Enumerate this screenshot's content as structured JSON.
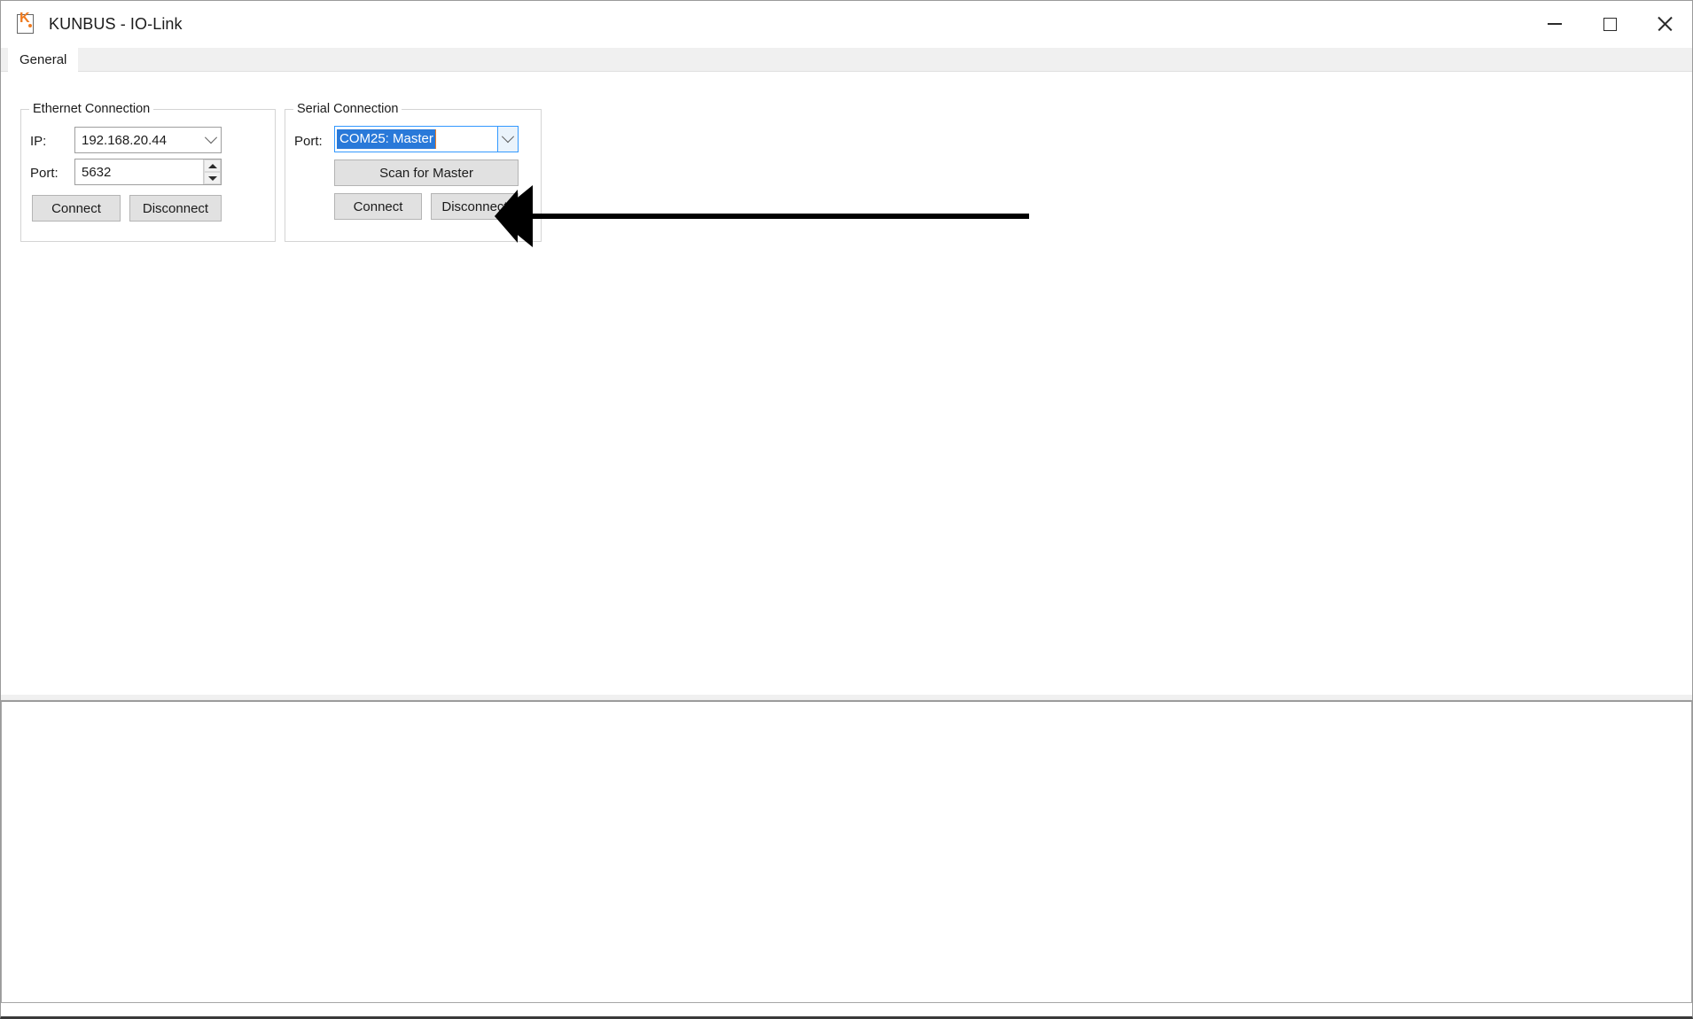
{
  "window": {
    "title": "KUNBUS - IO-Link",
    "icon": "kunbus-app-icon",
    "controls": {
      "minimize": "—",
      "maximize": "□",
      "close": "✕"
    }
  },
  "tabs": [
    {
      "label": "General",
      "active": true
    }
  ],
  "ethernet_group": {
    "title": "Ethernet Connection",
    "ip_label": "IP:",
    "ip_value": "192.168.20.44",
    "port_label": "Port:",
    "port_value": "5632",
    "connect_label": "Connect",
    "disconnect_label": "Disconnect"
  },
  "serial_group": {
    "title": "Serial Connection",
    "port_label": "Port:",
    "port_value": "COM25: Master",
    "scan_label": "Scan for Master",
    "connect_label": "Connect",
    "disconnect_label": "Disconnect"
  },
  "log_panel": {
    "content": ""
  },
  "annotation": {
    "kind": "arrow",
    "points_to": "serial-connect-button",
    "color": "#000000"
  },
  "colors": {
    "accent": "#ef7b20",
    "selection": "#2979d9",
    "focus_border": "#3399ff",
    "button_face": "#e1e1e1",
    "window_bg": "#ffffff"
  }
}
